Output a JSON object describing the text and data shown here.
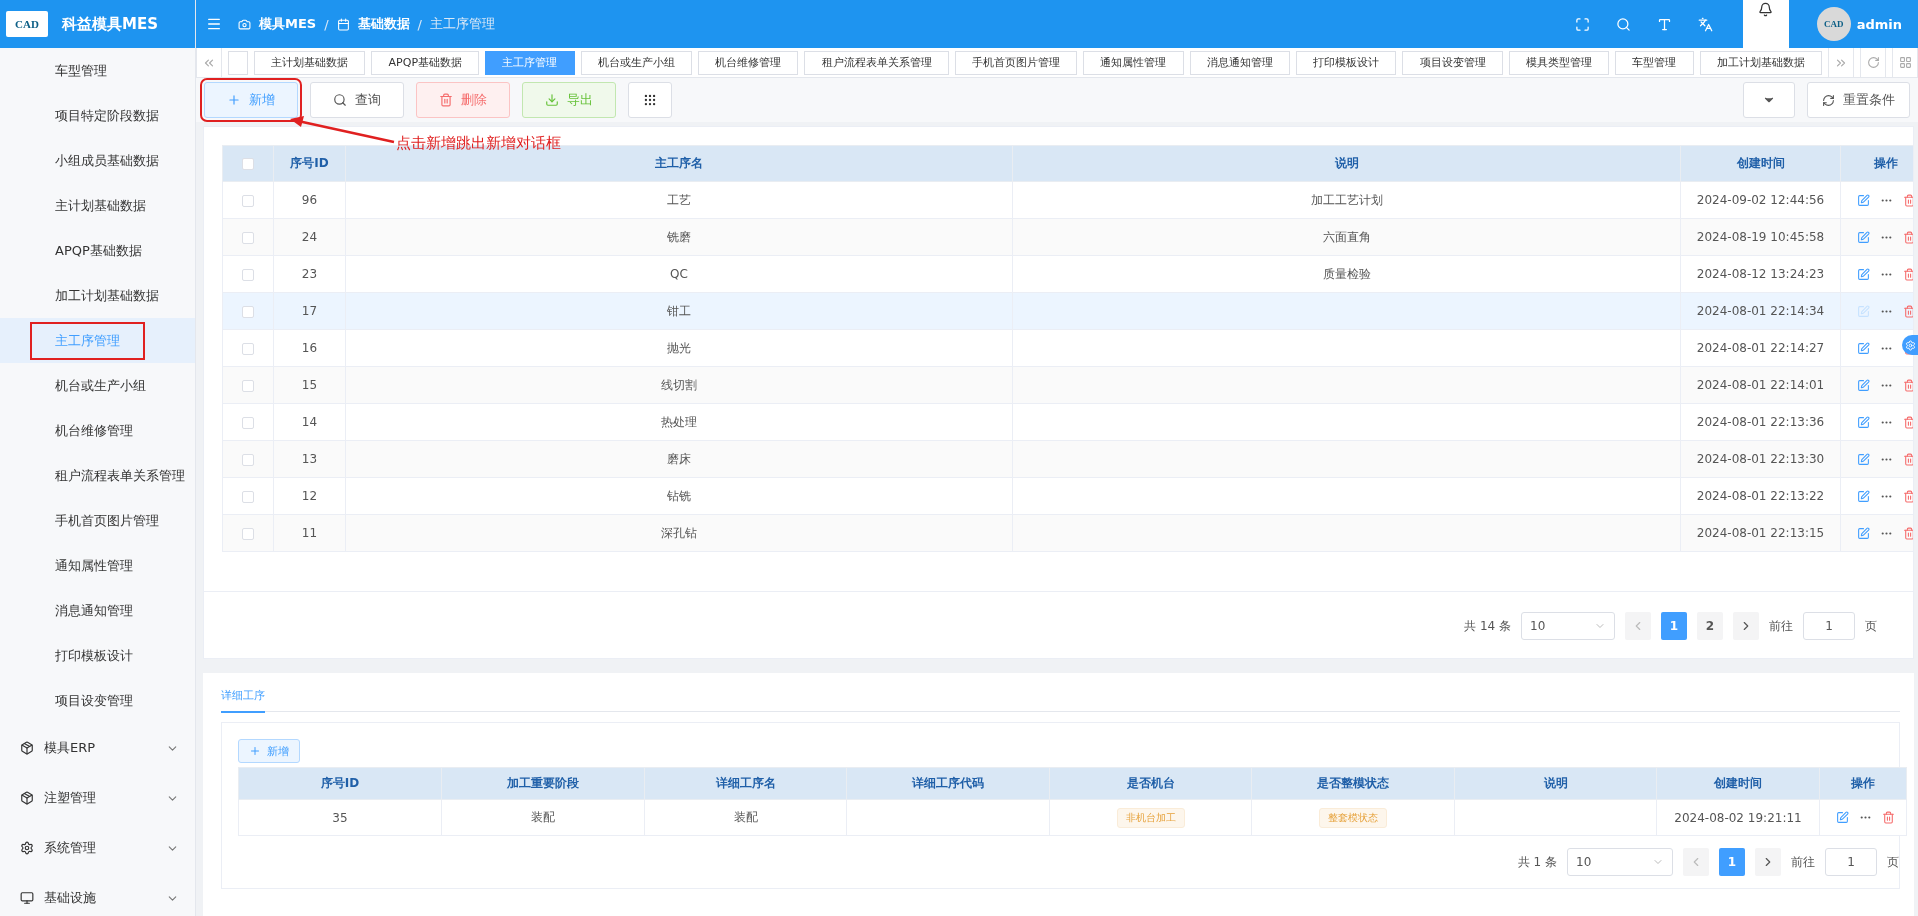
{
  "app": {
    "logo": "CAD",
    "title": "科益模具MES"
  },
  "breadcrumb_separator": "/",
  "breadcrumb": [
    {
      "label": "模具MES",
      "kind": "camera"
    },
    {
      "label": "基础数据",
      "kind": "calendar"
    },
    {
      "label": "主工序管理",
      "kind": "current"
    }
  ],
  "user": {
    "avatar": "CAD",
    "name": "admin"
  },
  "sidebar": {
    "items": [
      {
        "label": "车型管理",
        "selected": false,
        "highlighted": false
      },
      {
        "label": "项目特定阶段数据",
        "selected": false,
        "highlighted": false
      },
      {
        "label": "小组成员基础数据",
        "selected": false,
        "highlighted": false
      },
      {
        "label": "主计划基础数据",
        "selected": false,
        "highlighted": false
      },
      {
        "label": "APQP基础数据",
        "selected": false,
        "highlighted": false
      },
      {
        "label": "加工计划基础数据",
        "selected": false,
        "highlighted": false
      },
      {
        "label": "主工序管理",
        "selected": true,
        "highlighted": true
      },
      {
        "label": "机台或生产小组",
        "selected": false,
        "highlighted": false
      },
      {
        "label": "机台维修管理",
        "selected": false,
        "highlighted": false
      },
      {
        "label": "租户流程表单关系管理",
        "selected": false,
        "highlighted": false
      },
      {
        "label": "手机首页图片管理",
        "selected": false,
        "highlighted": false
      },
      {
        "label": "通知属性管理",
        "selected": false,
        "highlighted": false
      },
      {
        "label": "消息通知管理",
        "selected": false,
        "highlighted": false
      },
      {
        "label": "打印模板设计",
        "selected": false,
        "highlighted": false
      },
      {
        "label": "项目设变管理",
        "selected": false,
        "highlighted": false
      }
    ],
    "groups": [
      {
        "label": "模具ERP",
        "kind": "box",
        "expanded": false
      },
      {
        "label": "注塑管理",
        "kind": "box",
        "expanded": false
      },
      {
        "label": "系统管理",
        "kind": "gear",
        "expanded": false
      },
      {
        "label": "基础设施",
        "kind": "monitor",
        "expanded": false
      }
    ]
  },
  "tabs": [
    {
      "label": "主计划基础数据",
      "selected": false
    },
    {
      "label": "APQP基础数据",
      "selected": false
    },
    {
      "label": "主工序管理",
      "selected": true
    },
    {
      "label": "机台或生产小组",
      "selected": false
    },
    {
      "label": "机台维修管理",
      "selected": false
    },
    {
      "label": "租户流程表单关系管理",
      "selected": false
    },
    {
      "label": "手机首页图片管理",
      "selected": false
    },
    {
      "label": "通知属性管理",
      "selected": false
    },
    {
      "label": "消息通知管理",
      "selected": false
    },
    {
      "label": "打印模板设计",
      "selected": false
    },
    {
      "label": "项目设变管理",
      "selected": false
    },
    {
      "label": "模具类型管理",
      "selected": false
    },
    {
      "label": "车型管理",
      "selected": false
    },
    {
      "label": "加工计划基础数据",
      "selected": false
    }
  ],
  "toolbar": {
    "buttons": [
      {
        "label": "新增",
        "kind": "add",
        "highlighted": true
      },
      {
        "label": "查询",
        "kind": "search",
        "highlighted": false
      },
      {
        "label": "删除",
        "kind": "delete",
        "highlighted": false
      },
      {
        "label": "导出",
        "kind": "export",
        "highlighted": false
      }
    ],
    "reset": "重置条件"
  },
  "annotation": {
    "text": "点击新增跳出新增对话框"
  },
  "table": {
    "columns": [
      "序号ID",
      "主工序名",
      "说明",
      "创建时间",
      "操作"
    ],
    "header_checked": false,
    "rows": [
      {
        "id": "96",
        "name": "工艺",
        "description": "加工工艺计划",
        "time": "2024-09-02 12:44:56",
        "checked": false,
        "hovered": false
      },
      {
        "id": "24",
        "name": "铣磨",
        "description": "六面直角",
        "time": "2024-08-19 10:45:58",
        "checked": false,
        "hovered": false
      },
      {
        "id": "23",
        "name": "QC",
        "description": "质量检验",
        "time": "2024-08-12 13:24:23",
        "checked": false,
        "hovered": false
      },
      {
        "id": "17",
        "name": "钳工",
        "time": "2024-08-01 22:14:34",
        "checked": false,
        "hovered": true
      },
      {
        "id": "16",
        "name": "抛光",
        "time": "2024-08-01 22:14:27",
        "checked": false,
        "hovered": false
      },
      {
        "id": "15",
        "name": "线切割",
        "time": "2024-08-01 22:14:01",
        "checked": false,
        "hovered": false
      },
      {
        "id": "14",
        "name": "热处理",
        "time": "2024-08-01 22:13:36",
        "checked": false,
        "hovered": false
      },
      {
        "id": "13",
        "name": "磨床",
        "time": "2024-08-01 22:13:30",
        "checked": false,
        "hovered": false
      },
      {
        "id": "12",
        "name": "钻铣",
        "time": "2024-08-01 22:13:22",
        "checked": false,
        "hovered": false
      },
      {
        "id": "11",
        "name": "深孔钻",
        "time": "2024-08-01 22:13:15",
        "checked": false,
        "hovered": false
      }
    ],
    "pagination": {
      "total": "共 14 条",
      "page_size": "10",
      "pages": [
        {
          "label": "1",
          "selected": true
        },
        {
          "label": "2",
          "selected": false
        }
      ],
      "goto": "前往",
      "goto_value": "1",
      "unit": "页"
    }
  },
  "detail": {
    "tab": "详细工序",
    "add": "新增",
    "columns": [
      "序号ID",
      "加工重要阶段",
      "详细工序名",
      "详细工序代码",
      "是否机台",
      "是否整模状态",
      "说明",
      "创建时间",
      "操作"
    ],
    "rows": [
      {
        "cells": [
          {
            "kind": "text",
            "text": "35"
          },
          {
            "kind": "text",
            "text": "装配"
          },
          {
            "kind": "text",
            "text": "装配"
          },
          {
            "kind": "blank"
          },
          {
            "kind": "tag",
            "text": "非机台加工"
          },
          {
            "kind": "tag",
            "text": "整套模状态"
          },
          {
            "kind": "blank"
          },
          {
            "kind": "text",
            "text": "2024-08-02 19:21:11"
          },
          {
            "kind": "actions"
          }
        ]
      }
    ],
    "pagination": {
      "total": "共 1 条",
      "page_size": "10",
      "pages": [
        {
          "label": "1",
          "selected": true
        }
      ],
      "goto": "前往",
      "goto_value": "1",
      "unit": "页"
    }
  }
}
